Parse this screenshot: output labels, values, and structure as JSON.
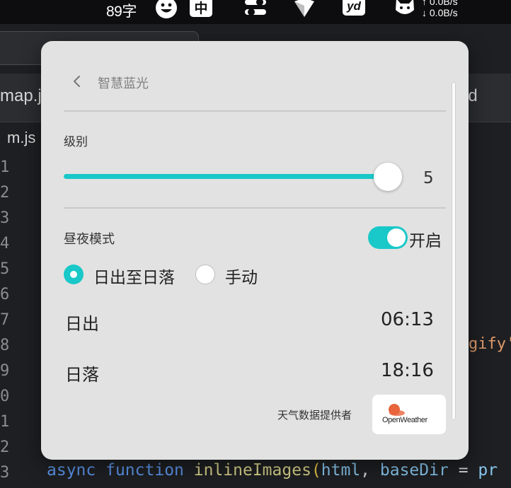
{
  "menubar": {
    "char_count": "89字",
    "ime_label": "中",
    "yd_label": "yd",
    "net_up": "↑ 0.0B/s",
    "net_down": "↓ 0.0B/s"
  },
  "editor": {
    "tab_left": "map.j",
    "tab_right": "nd",
    "file_tab": "m.js",
    "line_numbers": [
      "1",
      "2",
      "3",
      "4",
      "5",
      "6",
      "7",
      "8",
      "9",
      "0",
      "1",
      "2",
      "3"
    ],
    "code_fragment": "gify'",
    "code_line": {
      "kw1": "async",
      "kw2": "function",
      "fn": "inlineImages",
      "open": "(",
      "p1": "html",
      "comma": ",",
      "p2": "baseDir",
      "eq": "=",
      "rest": "pr"
    }
  },
  "panel": {
    "title": "智慧蓝光",
    "level": {
      "label": "级别",
      "value": "5",
      "fraction": 1.0
    },
    "day_night": {
      "label": "昼夜模式",
      "toggle_on": true,
      "toggle_text": "开启"
    },
    "options": {
      "sunrise_to_sunset": "日出至日落",
      "manual": "手动",
      "selected": "sunrise_to_sunset"
    },
    "sunrise": {
      "label": "日出",
      "time": "06:13"
    },
    "sunset": {
      "label": "日落",
      "time": "18:16"
    },
    "provider": {
      "label": "天气数据提供者",
      "logo_text": "OpenWeather"
    }
  },
  "colors": {
    "accent": "#19c8c8",
    "panel_bg": "#e2e2e2",
    "editor_bg": "#1e1f22"
  }
}
